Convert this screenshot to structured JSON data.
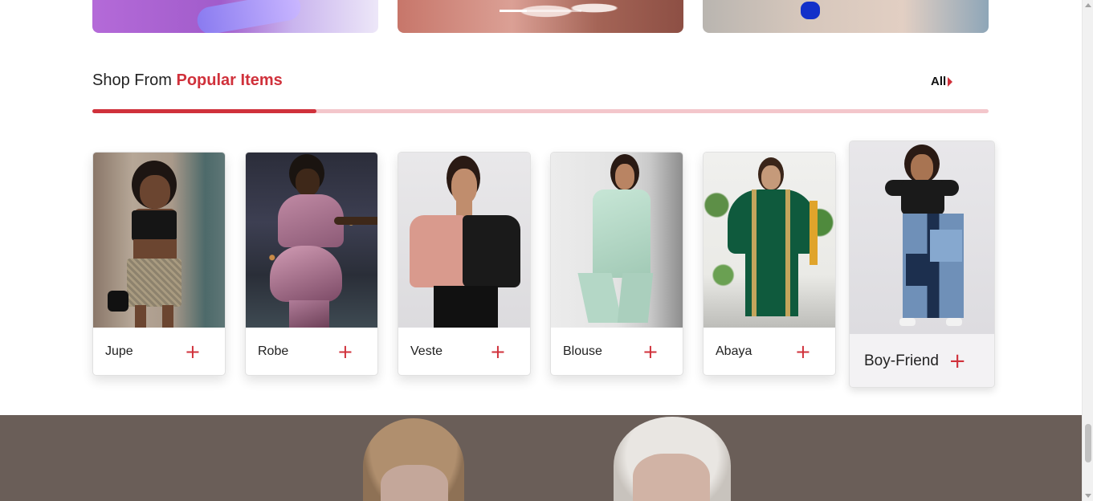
{
  "banners": [
    {
      "name": "banner-nails-purple"
    },
    {
      "name": "banner-nails-pink"
    },
    {
      "name": "banner-nails-blue"
    }
  ],
  "section": {
    "title_prefix": "Shop From",
    "title_accent": "Popular Items",
    "all_label": "All",
    "scroll_progress": 0.25
  },
  "products": [
    {
      "name": "Jupe",
      "add_icon": "plus-icon"
    },
    {
      "name": "Robe",
      "add_icon": "plus-icon"
    },
    {
      "name": "Veste",
      "add_icon": "plus-icon"
    },
    {
      "name": "Blouse",
      "add_icon": "plus-icon"
    },
    {
      "name": "Abaya",
      "add_icon": "plus-icon"
    },
    {
      "name": "Boy-Friend",
      "add_icon": "plus-icon"
    }
  ],
  "plus_glyph": "+",
  "colors": {
    "accent": "#d0313b",
    "track": "#f3c6cb",
    "lower_section": "#6a5e58"
  }
}
